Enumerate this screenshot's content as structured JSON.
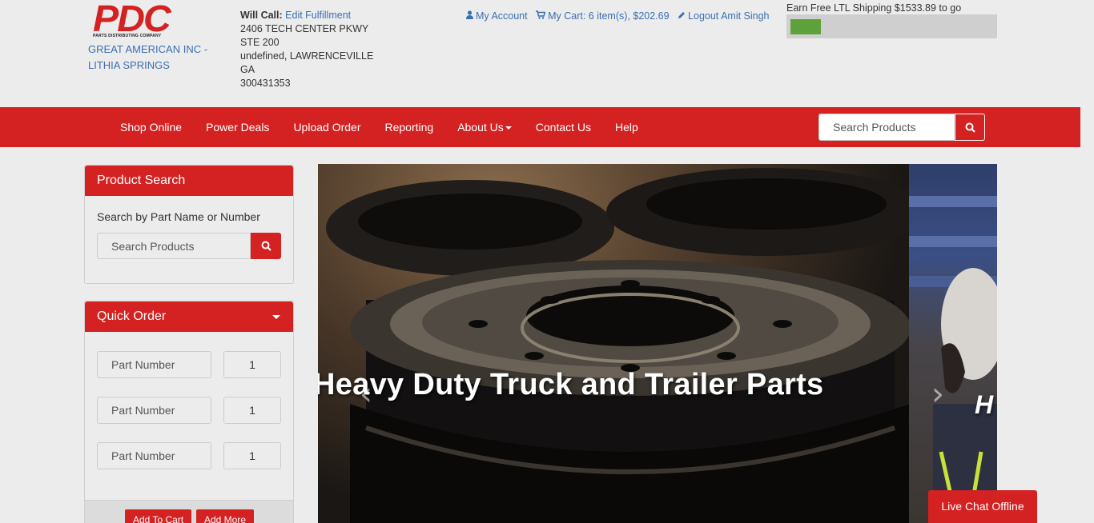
{
  "header": {
    "logo_text": "PDC",
    "logo_subtitle": "PARTS DISTRIBUTING COMPANY",
    "company_name": "GREAT AMERICAN INC - LITHIA SPRINGS",
    "will_call_label": "Will Call:",
    "edit_fulfillment": "Edit Fulfillment",
    "address_lines": [
      "2406 TECH CENTER PKWY",
      "STE 200",
      "undefined, LAWRENCEVILLE",
      "GA",
      "300431353"
    ],
    "my_account": "My Account",
    "my_cart": "My Cart: 6 item(s), $202.69",
    "logout": "Logout Amit Singh",
    "shipping_text": "Earn Free LTL Shipping $1533.89 to go",
    "shipping_progress": 0.15
  },
  "nav": {
    "items": [
      "Shop Online",
      "Power Deals",
      "Upload Order",
      "Reporting",
      "About Us",
      "Contact Us",
      "Help"
    ],
    "search_placeholder": "Search Products"
  },
  "product_search": {
    "title": "Product Search",
    "label": "Search by Part Name or Number",
    "placeholder": "Search Products"
  },
  "quick_order": {
    "title": "Quick Order",
    "rows": [
      {
        "placeholder": "Part Number",
        "qty": "1"
      },
      {
        "placeholder": "Part Number",
        "qty": "1"
      },
      {
        "placeholder": "Part Number",
        "qty": "1"
      }
    ],
    "add_to_cart": "Add To Cart",
    "add_more": "Add More"
  },
  "carousel": {
    "slide1_caption": "Heavy Duty Truck and Trailer Parts",
    "slide2_caption": "H"
  },
  "chat": {
    "label": "Live Chat Offline"
  },
  "colors": {
    "brand_red": "#d42121",
    "link_blue": "#3a6fb0",
    "progress_green": "#5da13a"
  }
}
